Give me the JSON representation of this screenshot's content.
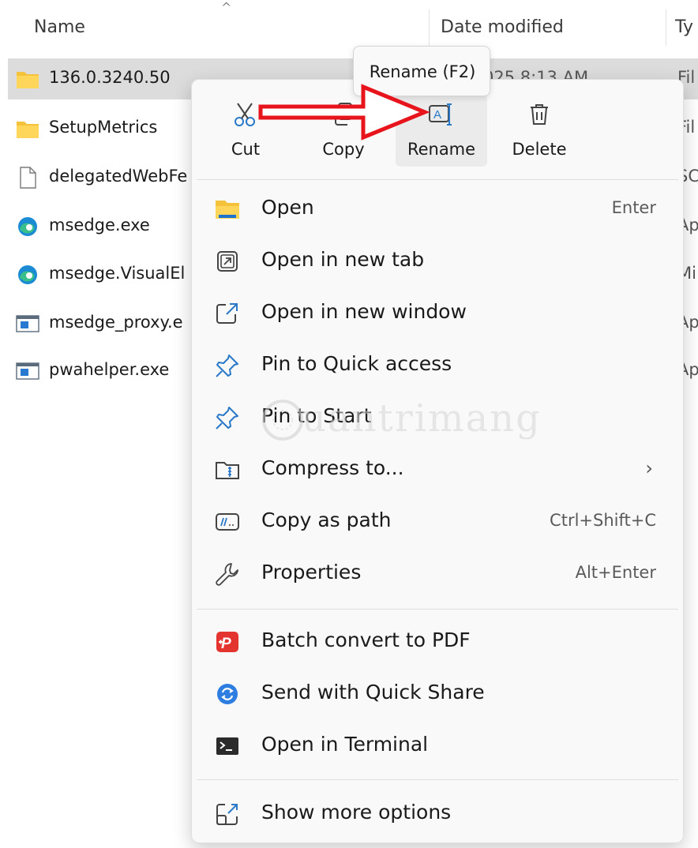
{
  "columns": {
    "name": "Name",
    "date_modified": "Date modified",
    "type": "Ty"
  },
  "files": [
    {
      "name": "136.0.3240.50",
      "icon": "folder-icon",
      "date": "025 8:13 AM",
      "type": "Fil",
      "selected": true
    },
    {
      "name": "SetupMetrics",
      "icon": "folder-icon",
      "type": "Fil"
    },
    {
      "name": "delegatedWebFe",
      "icon": "file-icon",
      "type": "SC"
    },
    {
      "name": "msedge.exe",
      "icon": "edge-icon",
      "type": "Ap"
    },
    {
      "name": "msedge.VisualEl",
      "icon": "edge-icon",
      "type": "Mi"
    },
    {
      "name": "msedge_proxy.e",
      "icon": "app-window-icon",
      "type": "Ap"
    },
    {
      "name": "pwahelper.exe",
      "icon": "app-window-icon",
      "type": "Ap"
    }
  ],
  "tooltip": "Rename (F2)",
  "quick_actions": [
    {
      "label": "Cut",
      "icon": "scissors-icon"
    },
    {
      "label": "Copy",
      "icon": "copy-icon"
    },
    {
      "label": "Rename",
      "icon": "rename-icon"
    },
    {
      "label": "Delete",
      "icon": "trash-icon"
    }
  ],
  "menu_items": [
    {
      "label": "Open",
      "shortcut": "Enter",
      "icon": "folder-open-icon"
    },
    {
      "label": "Open in new tab",
      "shortcut": "",
      "icon": "new-tab-icon"
    },
    {
      "label": "Open in new window",
      "shortcut": "",
      "icon": "new-window-icon"
    },
    {
      "label": "Pin to Quick access",
      "shortcut": "",
      "icon": "pin-icon"
    },
    {
      "label": "Pin to Start",
      "shortcut": "",
      "icon": "pin-icon"
    },
    {
      "label": "Compress to...",
      "shortcut": "",
      "icon": "zip-folder-icon",
      "submenu": true
    },
    {
      "label": "Copy as path",
      "shortcut": "Ctrl+Shift+C",
      "icon": "path-icon"
    },
    {
      "label": "Properties",
      "shortcut": "Alt+Enter",
      "icon": "wrench-icon"
    }
  ],
  "extra_items": [
    {
      "label": "Batch convert to PDF",
      "icon": "pdf-icon"
    },
    {
      "label": "Send with Quick Share",
      "icon": "quick-share-icon"
    },
    {
      "label": "Open in Terminal",
      "icon": "terminal-icon"
    }
  ],
  "more_options": {
    "label": "Show more options",
    "icon": "more-options-icon"
  },
  "submenu_chevron": "›",
  "watermark": "uantrimang",
  "colors": {
    "selection": "#dcdcdc",
    "menu_bg": "#f9f9f9",
    "folder": "#f5c33b",
    "accent_blue": "#0a6cd6",
    "annotation_red": "#e8141c"
  }
}
